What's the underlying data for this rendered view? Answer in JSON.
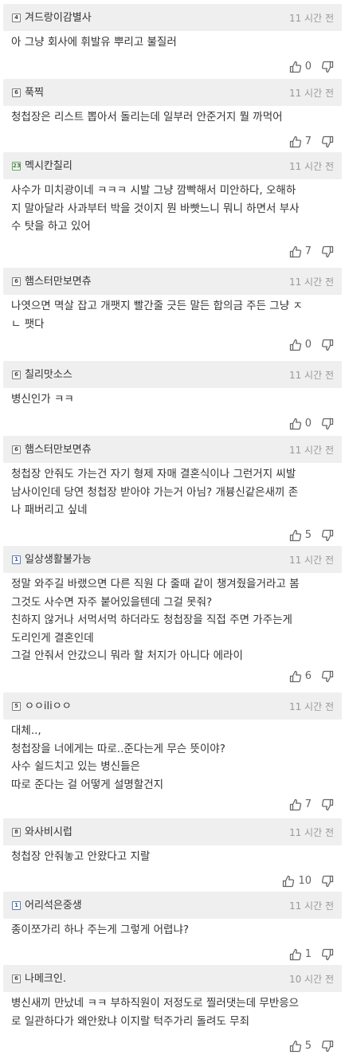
{
  "comments": [
    {
      "nick": "겨드랑이감별사",
      "level": "4",
      "time": "11 시간 전",
      "lines": [
        "아 그냥 회사에 휘발유 뿌리고 불질러"
      ],
      "likes": "0"
    },
    {
      "nick": "푹찍",
      "level": "6",
      "time": "11 시간 전",
      "lines": [
        "청첩장은 리스트 뽑아서 돌리는데 일부러 안준거지 뭘 까먹어"
      ],
      "likes": "7"
    },
    {
      "nick": "멕시칸칠리",
      "level": "23",
      "time": "11 시간 전",
      "lines": [
        "사수가 미치광이네 ㅋㅋㅋ 시발 그냥 깜빡해서 미안하다, 오해하",
        "지 말아달라 사과부터 박을 것이지 뭔 바빳느니 뭐니 하면서 부사",
        "수 탓을 하고 있어"
      ],
      "likes": "7"
    },
    {
      "nick": "햄스터만보면츄",
      "level": "6",
      "time": "11 시간 전",
      "lines": [
        "나엿으면 멱살 잡고 개팻지 빨간줄 긋든 말든 합의금 주든 그냥 ㅈ",
        "ㄴ 팻다"
      ],
      "likes": "0"
    },
    {
      "nick": "칠리맛소스",
      "level": "6",
      "time": "11 시간 전",
      "lines": [
        "병신인가 ㅋㅋ"
      ],
      "likes": "0"
    },
    {
      "nick": "햄스터만보면츄",
      "level": "6",
      "time": "11 시간 전",
      "lines": [
        "청첩장 안줘도 가는건 자기 형제 자매 결혼식이나 그런거지 씨발",
        "남사이인데 당연 청첩장 받아야 가는거 아님? 개븅신같은새끼 존",
        "나 패버리고 싶네"
      ],
      "likes": "5"
    },
    {
      "nick": "일상생활불가능",
      "level": "1",
      "time": "11 시간 전",
      "lines": [
        "정말 와주길 바랬으면 다른 직원 다 줄때 같이 챙겨줬을거라고 봄",
        "그것도 사수면 자주 붙어있을텐데 그걸 못줘?",
        "친하지 않거나 서먹서먹 하더라도 청첩장을 직접 주면 가주는게",
        "도리인게 결혼인데",
        "그걸 안줘서 안갔으니 뭐라 할 처지가 아니다 에라이"
      ],
      "likes": "6"
    },
    {
      "nick": "ㅇㅇiliㅇㅇ",
      "level": "5",
      "time": "11 시간 전",
      "lines": [
        "대체..,",
        "청첩장을 너에게는 따로..준다는게 무슨 뜻이야?",
        "사수 쉴드치고 있는 병신들은",
        "따로 준다는 걸 어떻게 설명할건지"
      ],
      "likes": "7"
    },
    {
      "nick": "와사비시럽",
      "level": "8",
      "time": "11 시간 전",
      "lines": [
        "청첩장 안줘놓고 안왔다고 지랄"
      ],
      "likes": "10"
    },
    {
      "nick": "어리석은중생",
      "level": "1",
      "time": "11 시간 전",
      "lines": [
        "종이쪼가리 하나 주는게 그렇게 어렵냐?"
      ],
      "likes": "1"
    },
    {
      "nick": "나메크인.",
      "level": "6",
      "time": "10 시간 전",
      "lines": [
        "병신새끼 만났네 ㅋㅋ 부하직원이 저정도로 찔러댓는데 무반응으",
        "로 일관하다가 왜안왔냐 이지랄 턱주가리 돌려도 무죄"
      ],
      "likes": "5"
    }
  ],
  "icons": {
    "like": "thumbs-up-icon",
    "dislike": "thumbs-down-icon",
    "level": "level-badge-icon"
  },
  "colors": {
    "header_bg": "#efefef",
    "time": "#999999",
    "text": "#333333",
    "icon": "#666666"
  }
}
